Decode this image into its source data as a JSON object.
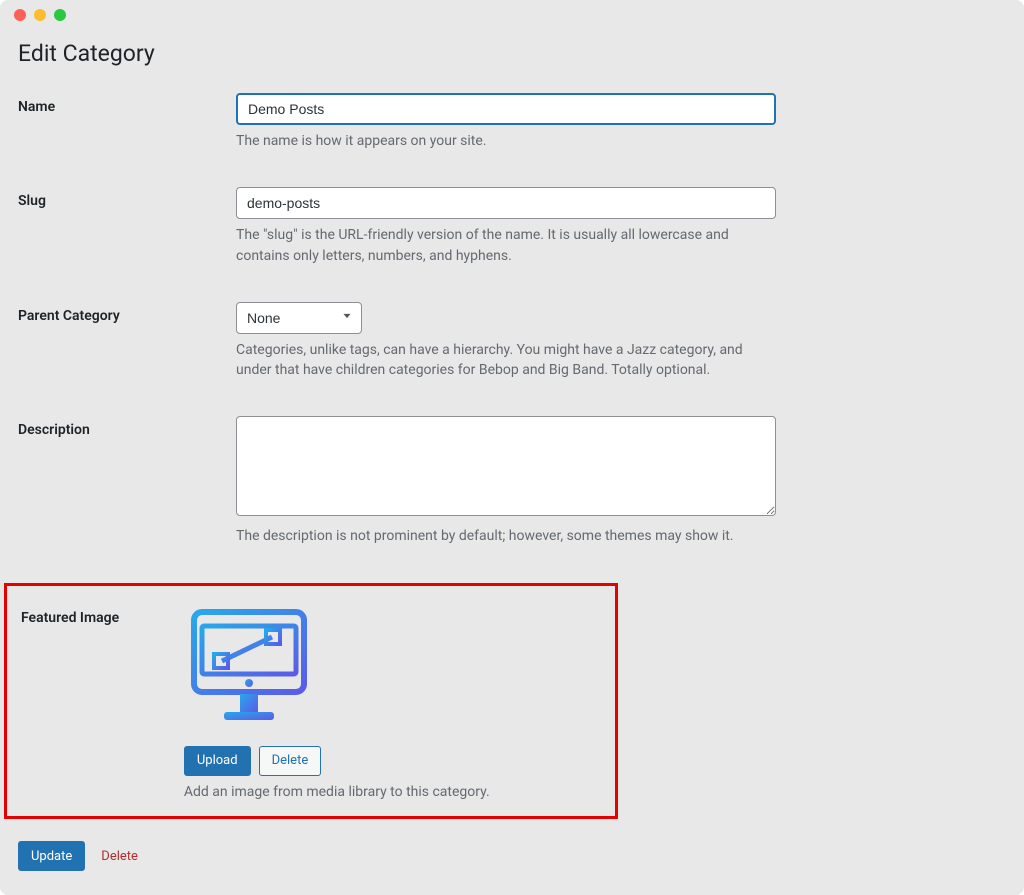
{
  "page": {
    "title": "Edit Category"
  },
  "form": {
    "name": {
      "label": "Name",
      "value": "Demo Posts",
      "help": "The name is how it appears on your site."
    },
    "slug": {
      "label": "Slug",
      "value": "demo-posts",
      "help": "The \"slug\" is the URL-friendly version of the name. It is usually all lowercase and contains only letters, numbers, and hyphens."
    },
    "parent": {
      "label": "Parent Category",
      "selected": "None",
      "help": "Categories, unlike tags, can have a hierarchy. You might have a Jazz category, and under that have children categories for Bebop and Big Band. Totally optional."
    },
    "description": {
      "label": "Description",
      "value": "",
      "help": "The description is not prominent by default; however, some themes may show it."
    },
    "featured_image": {
      "label": "Featured Image",
      "upload_label": "Upload",
      "delete_label": "Delete",
      "help": "Add an image from media library to this category."
    }
  },
  "actions": {
    "update_label": "Update",
    "delete_label": "Delete"
  }
}
